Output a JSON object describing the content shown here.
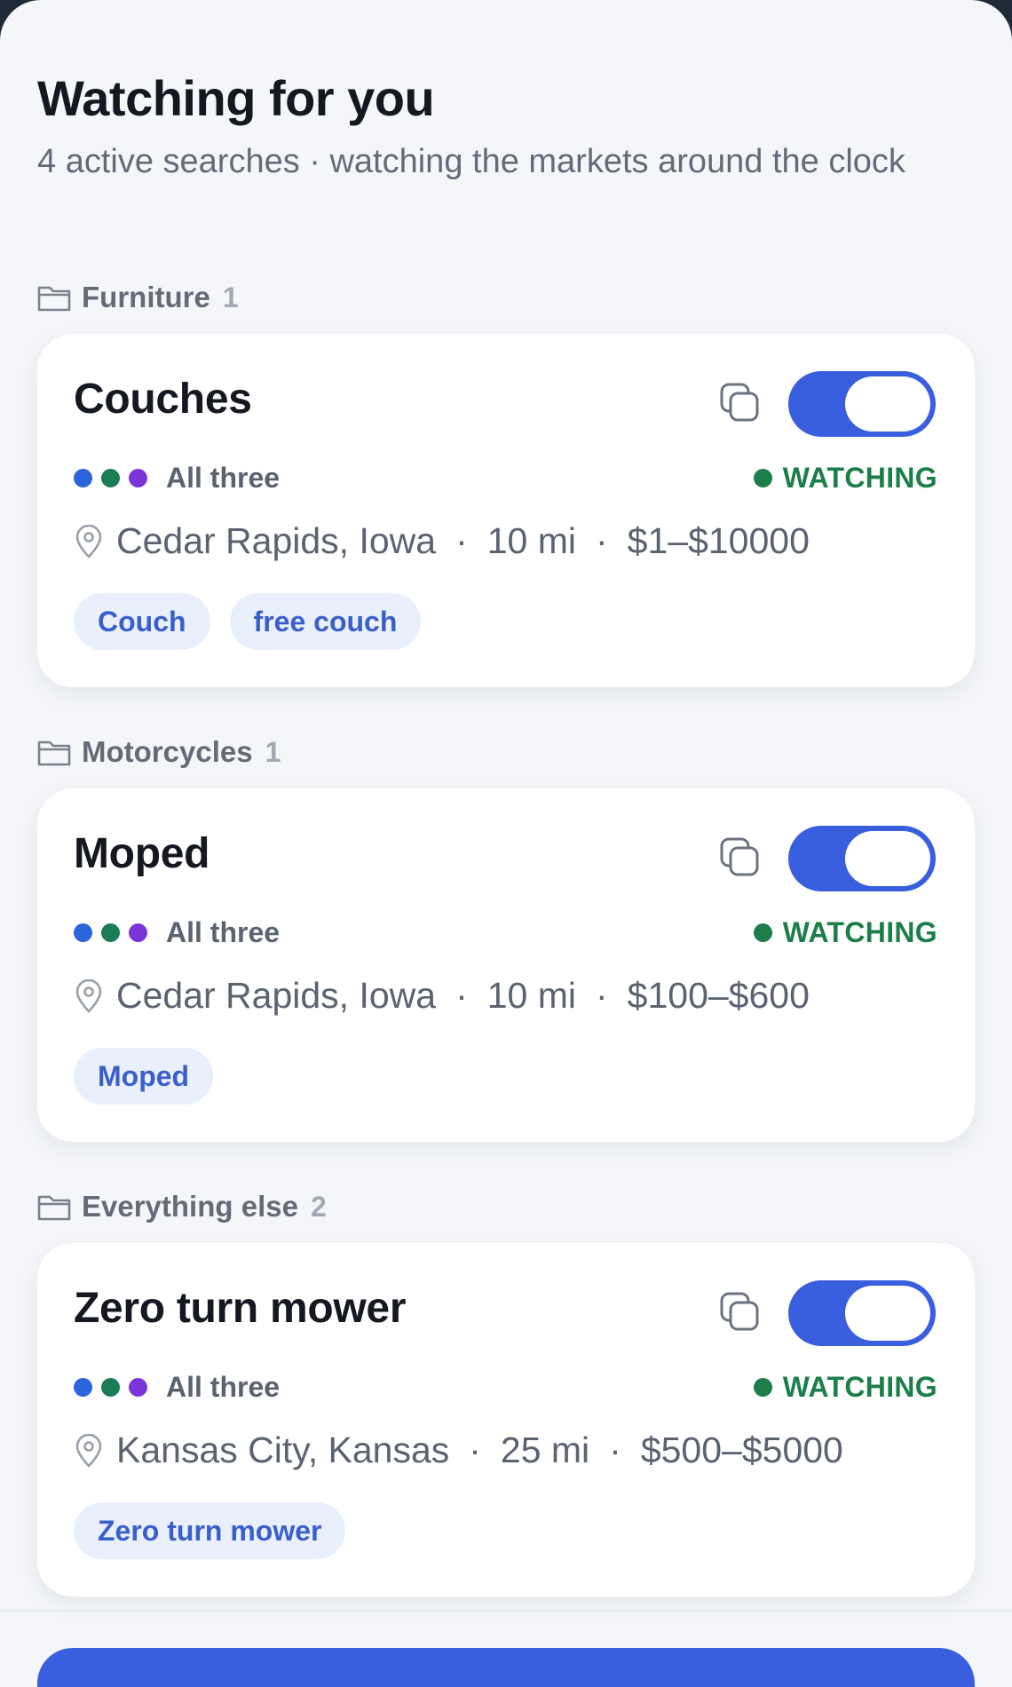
{
  "header": {
    "title": "Watching for you",
    "subtitle": "4 active searches · watching the markets around the clock"
  },
  "colors": {
    "accent": "#3a5fde",
    "watching": "#1c7e4a",
    "source_dots": [
      "#2c64db",
      "#1b7d55",
      "#7a35d8"
    ]
  },
  "groups": [
    {
      "name": "Furniture",
      "count": "1",
      "searches": [
        {
          "title": "Couches",
          "enabled": true,
          "sources_label": "All three",
          "status": "WATCHING",
          "location": "Cedar Rapids, Iowa",
          "radius": "10 mi",
          "price": "$1–$10000",
          "keywords": [
            "Couch",
            "free couch"
          ]
        }
      ]
    },
    {
      "name": "Motorcycles",
      "count": "1",
      "searches": [
        {
          "title": "Moped",
          "enabled": true,
          "sources_label": "All three",
          "status": "WATCHING",
          "location": "Cedar Rapids, Iowa",
          "radius": "10 mi",
          "price": "$100–$600",
          "keywords": [
            "Moped"
          ]
        }
      ]
    },
    {
      "name": "Everything else",
      "count": "2",
      "searches": [
        {
          "title": "Zero turn mower",
          "enabled": true,
          "sources_label": "All three",
          "status": "WATCHING",
          "location": "Kansas City, Kansas",
          "radius": "25 mi",
          "price": "$500–$5000",
          "keywords": [
            "Zero turn mower"
          ]
        }
      ]
    }
  ]
}
